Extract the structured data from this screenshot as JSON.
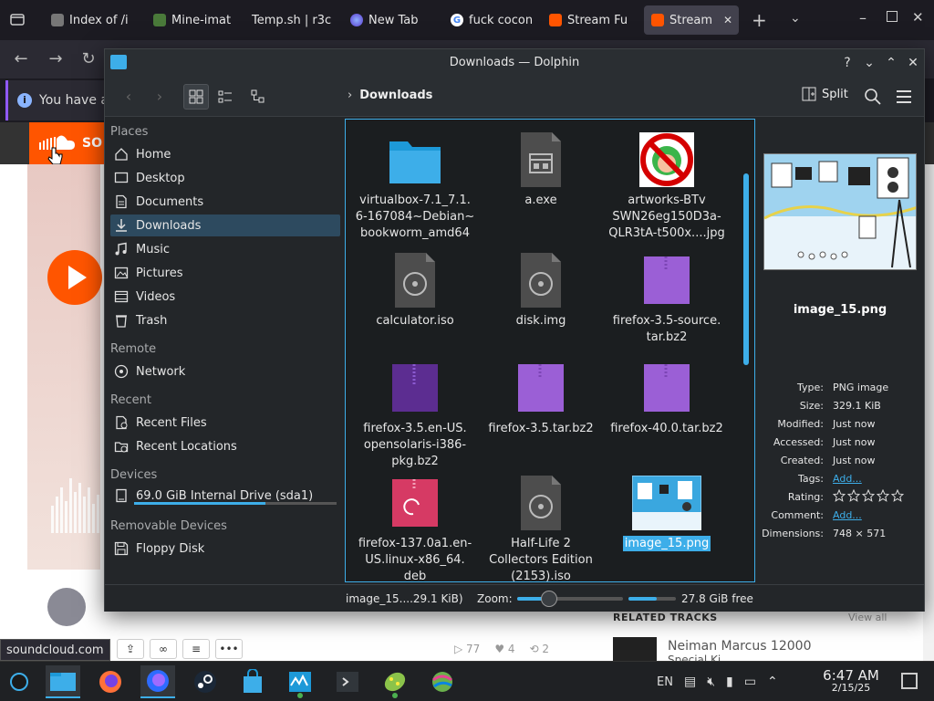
{
  "browser": {
    "tabs": [
      {
        "label": "Index of /i",
        "icon": "folder-icon",
        "active": false
      },
      {
        "label": "Mine-imat",
        "icon": "minecraft-icon",
        "active": false
      },
      {
        "label": "Temp.sh | r3c",
        "icon": "none",
        "active": false
      },
      {
        "label": "New Tab",
        "icon": "firefox-icon",
        "active": false
      },
      {
        "label": "fuck cocon",
        "icon": "google-icon",
        "active": false
      },
      {
        "label": "Stream Fu",
        "icon": "soundcloud-icon",
        "active": false
      },
      {
        "label": "Stream",
        "icon": "soundcloud-icon",
        "active": true
      }
    ],
    "notification_text": "You have an",
    "soundcloud": {
      "logo_text": "SO",
      "status_url": "soundcloud.com",
      "likes": "77",
      "hearts": "4",
      "reposts": "2",
      "related_header": "RELATED TRACKS",
      "view_all": "View all",
      "related_title": "Neiman Marcus 12000",
      "related_sub": "Special Ki..."
    }
  },
  "dolphin": {
    "title": "Downloads — Dolphin",
    "breadcrumb": "Downloads",
    "split_label": "Split",
    "places": {
      "sections": [
        {
          "header": "Places",
          "items": [
            {
              "label": "Home",
              "icon": "home-icon"
            },
            {
              "label": "Desktop",
              "icon": "desktop-icon"
            },
            {
              "label": "Documents",
              "icon": "documents-icon"
            },
            {
              "label": "Downloads",
              "icon": "downloads-icon",
              "selected": true
            },
            {
              "label": "Music",
              "icon": "music-icon"
            },
            {
              "label": "Pictures",
              "icon": "pictures-icon"
            },
            {
              "label": "Videos",
              "icon": "videos-icon"
            },
            {
              "label": "Trash",
              "icon": "trash-icon"
            }
          ]
        },
        {
          "header": "Remote",
          "items": [
            {
              "label": "Network",
              "icon": "network-icon"
            }
          ]
        },
        {
          "header": "Recent",
          "items": [
            {
              "label": "Recent Files",
              "icon": "recent-files-icon"
            },
            {
              "label": "Recent Locations",
              "icon": "recent-locations-icon"
            }
          ]
        },
        {
          "header": "Devices",
          "items": [
            {
              "label": "69.0 GiB Internal Drive (sda1)",
              "icon": "drive-icon",
              "usage": 0.65
            }
          ]
        },
        {
          "header": "Removable Devices",
          "items": [
            {
              "label": "Floppy Disk",
              "icon": "floppy-icon"
            }
          ]
        }
      ]
    },
    "files": [
      {
        "name": "virtualbox-7.1_7.1.\n6-167084~Debian~\nbookworm_amd64",
        "icon": "folder-icon"
      },
      {
        "name": "a.exe",
        "icon": "exe-icon"
      },
      {
        "name": "artworks-BTv\nSWN26eg150D3a-\nQLR3tA-t500x....jpg",
        "icon": "image-thumb-icon"
      },
      {
        "name": "calculator.iso",
        "icon": "disc-image-icon"
      },
      {
        "name": "disk.img",
        "icon": "disc-image-icon"
      },
      {
        "name": "firefox-3.5-source.\ntar.bz2",
        "icon": "archive-icon"
      },
      {
        "name": "firefox-3.5.en-US.\nopensolaris-i386-\npkg.bz2",
        "icon": "archive-dark-icon"
      },
      {
        "name": "firefox-3.5.tar.bz2",
        "icon": "archive-icon"
      },
      {
        "name": "firefox-40.0.tar.bz2",
        "icon": "archive-icon"
      },
      {
        "name": "firefox-137.0a1.en-\nUS.linux-x86_64.\ndeb",
        "icon": "debian-package-icon"
      },
      {
        "name": "Half-Life 2\nCollectors Edition\n(2153).iso",
        "icon": "disc-image-icon"
      },
      {
        "name": "image_15.png",
        "icon": "png-thumb-icon",
        "selected": true
      }
    ],
    "info": {
      "name": "image_15.png",
      "rows": [
        {
          "key": "Type:",
          "value": "PNG image"
        },
        {
          "key": "Size:",
          "value": "329.1 KiB"
        },
        {
          "key": "Modified:",
          "value": "Just now"
        },
        {
          "key": "Accessed:",
          "value": "Just now"
        },
        {
          "key": "Created:",
          "value": "Just now"
        },
        {
          "key": "Tags:",
          "value": "Add...",
          "link": true
        },
        {
          "key": "Rating:",
          "value": ""
        },
        {
          "key": "Comment:",
          "value": "Add...",
          "link": true
        },
        {
          "key": "Dimensions:",
          "value": "748 × 571"
        }
      ]
    },
    "status": {
      "selection_text": "image_15....29.1 KiB)",
      "zoom_label": "Zoom:",
      "zoom_level": 0.3,
      "free_text": "27.8 GiB free",
      "free_fraction": 0.6
    }
  },
  "taskbar": {
    "language": "EN",
    "time": "6:47 AM",
    "date": "2/15/25"
  },
  "colors": {
    "accent": "#3daee9",
    "window_bg": "#232629",
    "soundcloud_orange": "#ff5500",
    "archive_purple": "#9b5fd6"
  }
}
